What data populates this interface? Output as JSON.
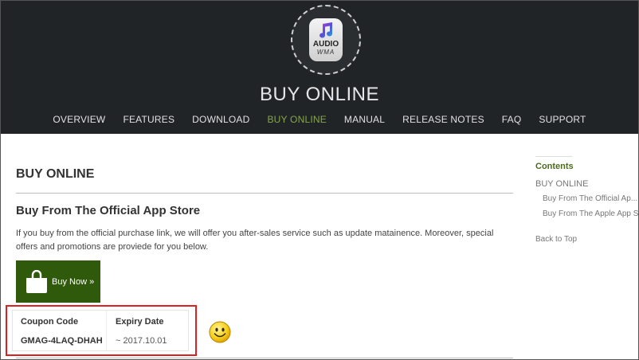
{
  "logo": {
    "line1": "AUDIO",
    "line2": "WMA"
  },
  "site_title": "BUY ONLINE",
  "nav": {
    "items": [
      {
        "label": "OVERVIEW",
        "active": false
      },
      {
        "label": "FEATURES",
        "active": false
      },
      {
        "label": "DOWNLOAD",
        "active": false
      },
      {
        "label": "BUY ONLINE",
        "active": true
      },
      {
        "label": "MANUAL",
        "active": false
      },
      {
        "label": "RELEASE NOTES",
        "active": false
      },
      {
        "label": "FAQ",
        "active": false
      },
      {
        "label": "SUPPORT",
        "active": false
      }
    ]
  },
  "main": {
    "heading": "BUY ONLINE",
    "section_heading": "Buy From The Official App Store",
    "body": "If you buy from the official purchase link, we will offer you after-sales service such as update matainence. Moreover, special offers and promotions are proviede for you below.",
    "buy_button": "Buy Now »"
  },
  "coupon": {
    "header_code": "Coupon Code",
    "header_expiry": "Expiry Date",
    "code": "GMAG-4LAQ-DHAH",
    "expiry": "~ 2017.10.01"
  },
  "sidebar": {
    "title": "Contents",
    "link_main": "BUY ONLINE",
    "sub1": "Buy From The Official Ap...",
    "sub2": "Buy From The Apple App S...",
    "back": "Back to Top"
  },
  "colors": {
    "header_bg": "#212427",
    "nav_active": "#86a746",
    "buy_button_bg": "#2f5a0c",
    "highlight_border": "#e02020"
  }
}
